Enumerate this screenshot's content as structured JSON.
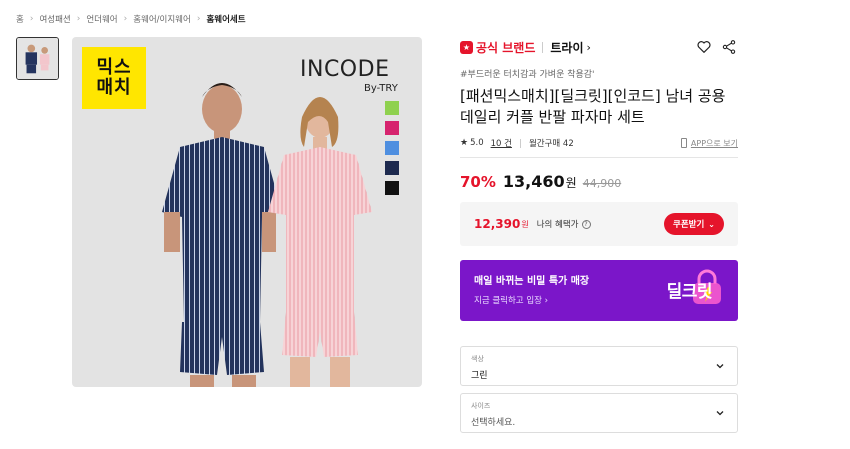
{
  "breadcrumb": [
    "홈",
    "여성패션",
    "언더웨어",
    "홈웨어/이지웨어",
    "홈웨어세트"
  ],
  "image": {
    "badge_line1": "믹스",
    "badge_line2": "매치",
    "brand_logo": "INCODE",
    "brand_sub": "By-TRY",
    "swatches": [
      "#8fd14f",
      "#d6246e",
      "#4f8fe0",
      "#1e2a4f",
      "#111111"
    ]
  },
  "brand": {
    "official_label": "공식 브랜드",
    "name": "트라이",
    "chevron": "›"
  },
  "product": {
    "tagline": "#부드러운 터치감과 가벼운 착용감'",
    "title": "[패션믹스매치][딜크릿][인코드] 남녀 공용 데일리 커플 반팔 파자마 세트",
    "rating_star": "★",
    "rating": "5.0",
    "reviews": "10 건",
    "monthly_purchase": "월간구매 42",
    "app_link": "APP으로 보기"
  },
  "price": {
    "discount": "70%",
    "amount": "13,460",
    "unit": "원",
    "original": "44,900"
  },
  "benefit": {
    "price": "12,390",
    "unit": "원",
    "label": "나의 혜택가",
    "help": "?",
    "coupon_button": "쿠폰받기",
    "coupon_chev": "⌄"
  },
  "deal_banner": {
    "title": "매일 바뀌는 비밀 특가 매장",
    "subtitle": "지금 클릭하고 입장 ›",
    "logo": "딜크릿"
  },
  "options": {
    "color": {
      "label": "색상",
      "value": "그린"
    },
    "size": {
      "label": "사이즈",
      "placeholder": "선택하세요."
    }
  },
  "colors": {
    "accent_red": "#e5142b",
    "deal_purple": "#7b16c9",
    "badge_yellow": "#ffe600"
  }
}
